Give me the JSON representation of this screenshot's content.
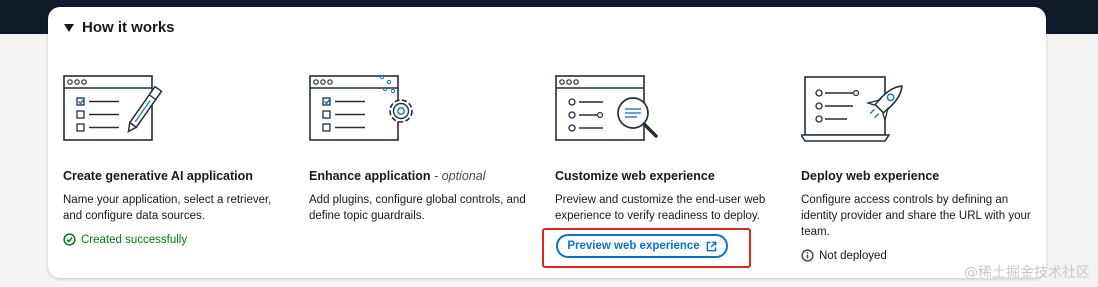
{
  "section": {
    "title": "How it works"
  },
  "steps": [
    {
      "title": "Create generative AI application",
      "title_suffix": "",
      "description": "Name your application, select a retriever, and configure data sources.",
      "status": "Created successfully",
      "status_icon": "check-circle-icon"
    },
    {
      "title": "Enhance application",
      "title_suffix": "- optional",
      "description": "Add plugins, configure global controls, and define topic guardrails."
    },
    {
      "title": "Customize web experience",
      "title_suffix": "",
      "description": "Preview and customize the end-user web experience to verify readiness to deploy.",
      "button_label": "Preview web experience",
      "button_icon": "external-link-icon"
    },
    {
      "title": "Deploy web experience",
      "title_suffix": "",
      "description": "Configure access controls by defining an identity provider and share the URL with your team.",
      "status": "Not deployed",
      "status_icon": "info-circle-icon"
    }
  ],
  "watermark": "@稀土掘金技术社区",
  "colors": {
    "success": "#037f0c",
    "link": "#0972d3",
    "highlight": "#e2261b",
    "illustration_accent": "#0972d3"
  }
}
